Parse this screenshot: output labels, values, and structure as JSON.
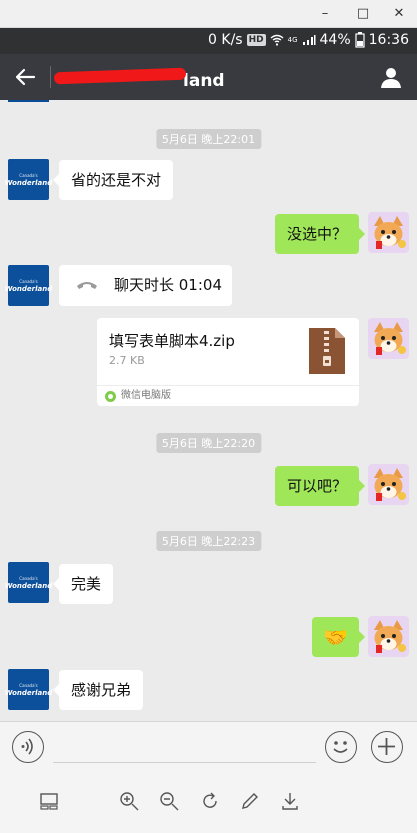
{
  "titlebar": {
    "minimize": "–",
    "maximize": "□",
    "close": "✕"
  },
  "statusbar": {
    "speed": "0 K/s",
    "hd": "HD",
    "network": "4G",
    "battery": "44%",
    "time": "16:36"
  },
  "chat": {
    "title": "land",
    "messages": [
      {
        "type": "time",
        "text": "5月6日 晚上22:01"
      },
      {
        "type": "text",
        "side": "left",
        "text": "省的还是不对"
      },
      {
        "type": "text",
        "side": "right",
        "text": "没选中？"
      },
      {
        "type": "call",
        "side": "left",
        "text": "聊天时长 01:04"
      },
      {
        "type": "file",
        "side": "right",
        "file_name": "填写表单脚本4.zip",
        "size": "2.7 KB",
        "source": "微信电脑版"
      },
      {
        "type": "time",
        "text": "5月6日 晚上22:20"
      },
      {
        "type": "text",
        "side": "right",
        "text": "可以吧？"
      },
      {
        "type": "time",
        "text": "5月6日 晚上22:23"
      },
      {
        "type": "text",
        "side": "left",
        "text": "完美"
      },
      {
        "type": "emoji",
        "side": "right",
        "emoji": "🤝"
      },
      {
        "type": "text",
        "side": "left",
        "text": "感谢兄弟"
      }
    ]
  },
  "avatar_left": {
    "small_text": "Canada's",
    "brand": "Wonderland"
  },
  "icons": {
    "back": "back-arrow-icon",
    "user": "user-profile-icon",
    "voice": "voice-input-icon",
    "emoji": "emoji-face-icon",
    "plus": "plus-icon",
    "layout": "layout-icon",
    "zoom_in": "zoom-in-icon",
    "zoom_out": "zoom-out-icon",
    "rotate": "rotate-icon",
    "edit": "edit-pencil-icon",
    "download": "download-icon"
  },
  "colors": {
    "green_bubble": "#9fe658",
    "nav_bg": "#393a3f",
    "chat_bg": "#ebebeb",
    "avatar_blue": "#0c4f9b"
  }
}
